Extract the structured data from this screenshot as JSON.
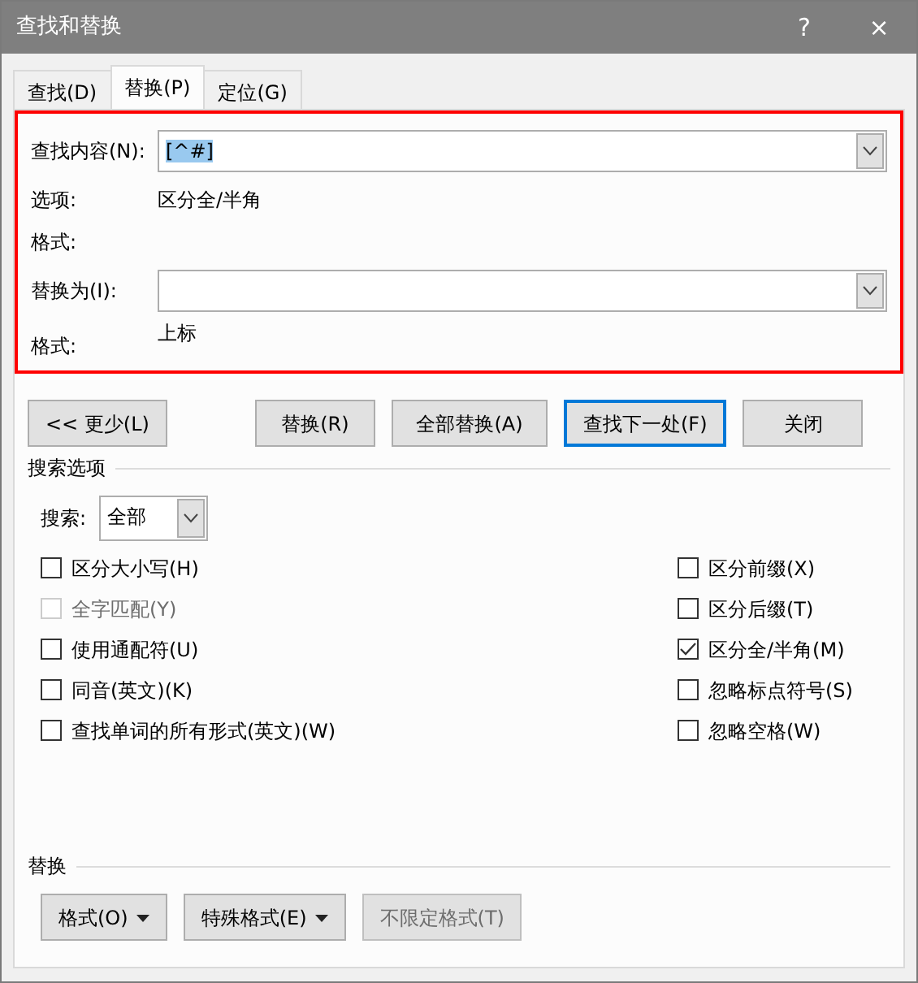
{
  "window": {
    "title": "查找和替换",
    "help": "?",
    "close": "×"
  },
  "tabs": [
    {
      "label": "查找(D)",
      "selected": false
    },
    {
      "label": "替换(P)",
      "selected": true
    },
    {
      "label": "定位(G)",
      "selected": false
    }
  ],
  "find": {
    "label": "查找内容(N):",
    "value": "[^#]",
    "options_label": "选项:",
    "options_value": "区分全/半角",
    "format_label": "格式:"
  },
  "replace": {
    "label": "替换为(I):",
    "format_label": "格式:",
    "format_value": "上标"
  },
  "buttons": [
    {
      "label": "<< 更少(L)",
      "default": false
    },
    {
      "label": "替换(R)",
      "default": false
    },
    {
      "label": "全部替换(A)",
      "default": false
    },
    {
      "label": "查找下一处(F)",
      "default": true
    },
    {
      "label": "关闭",
      "default": false
    }
  ],
  "search_options": {
    "heading": "搜索选项",
    "search_label": "搜索:",
    "search_value": "全部",
    "left": [
      {
        "label": "区分大小写(H)",
        "checked": false,
        "disabled": false
      },
      {
        "label": "全字匹配(Y)",
        "checked": false,
        "disabled": true
      },
      {
        "label": "使用通配符(U)",
        "checked": false,
        "disabled": false
      },
      {
        "label": "同音(英文)(K)",
        "checked": false,
        "disabled": false
      },
      {
        "label": "查找单词的所有形式(英文)(W)",
        "checked": false,
        "disabled": false
      }
    ],
    "right": [
      {
        "label": "区分前缀(X)",
        "checked": false,
        "disabled": false
      },
      {
        "label": "区分后缀(T)",
        "checked": false,
        "disabled": false
      },
      {
        "label": "区分全/半角(M)",
        "checked": true,
        "disabled": false
      },
      {
        "label": "忽略标点符号(S)",
        "checked": false,
        "disabled": false
      },
      {
        "label": "忽略空格(W)",
        "checked": false,
        "disabled": false
      }
    ]
  },
  "replace_section": {
    "heading": "替换",
    "buttons": [
      {
        "label": "格式(O)",
        "kind": "dropdown",
        "disabled": false
      },
      {
        "label": "特殊格式(E)",
        "kind": "dropdown",
        "disabled": false
      },
      {
        "label": "不限定格式(T)",
        "kind": "plain",
        "disabled": true
      }
    ]
  }
}
